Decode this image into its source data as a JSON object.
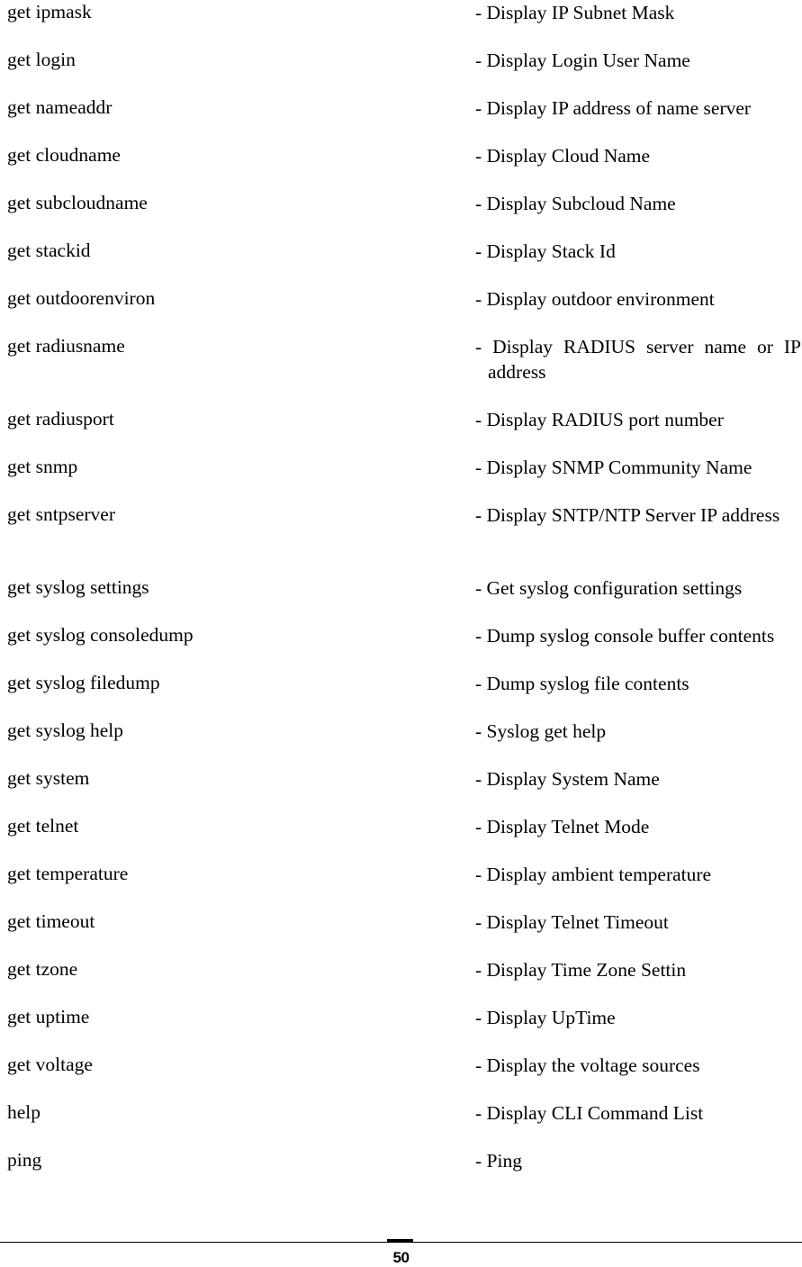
{
  "document": {
    "page_number": "50"
  },
  "command_list": {
    "rows": [
      {
        "command": "get ipmask",
        "description": "- Display IP Subnet Mask",
        "wrapped": false,
        "justified": false
      },
      {
        "command": "get login",
        "description": "- Display Login User Name",
        "wrapped": false,
        "justified": false
      },
      {
        "command": "get nameaddr",
        "description": "- Display IP address of name server",
        "wrapped": false,
        "justified": false
      },
      {
        "command": "get cloudname",
        "description": "- Display Cloud Name",
        "wrapped": false,
        "justified": false
      },
      {
        "command": "get subcloudname",
        "description": "- Display Subcloud Name",
        "wrapped": false,
        "justified": false
      },
      {
        "command": "get stackid",
        "description": "- Display Stack Id",
        "wrapped": false,
        "justified": false
      },
      {
        "command": "get outdoorenviron",
        "description": "- Display outdoor environment",
        "wrapped": false,
        "justified": false
      },
      {
        "command": "get radiusname",
        "description": "- Display RADIUS server name or IP address",
        "wrapped": true,
        "justified": true
      },
      {
        "command": "get radiusport",
        "description": "- Display RADIUS port number",
        "wrapped": false,
        "justified": false
      },
      {
        "command": "get snmp",
        "description": "- Display SNMP Community Name",
        "wrapped": false,
        "justified": false
      },
      {
        "command": "get sntpserver",
        "description": "- Display SNTP/NTP Server IP address",
        "wrapped": true,
        "justified": false
      },
      {
        "command": "get syslog settings",
        "description": "- Get syslog configuration settings",
        "wrapped": false,
        "justified": false
      },
      {
        "command": "get syslog consoledump",
        "description": "- Dump syslog console buffer contents",
        "wrapped": false,
        "justified": false
      },
      {
        "command": "get syslog filedump",
        "description": "- Dump syslog file contents",
        "wrapped": false,
        "justified": false
      },
      {
        "command": "get syslog help",
        "description": "- Syslog get help",
        "wrapped": false,
        "justified": false
      },
      {
        "command": "get system",
        "description": "- Display System Name",
        "wrapped": false,
        "justified": false
      },
      {
        "command": "get telnet",
        "description": "- Display Telnet Mode",
        "wrapped": false,
        "justified": false
      },
      {
        "command": "get temperature",
        "description": "- Display ambient temperature",
        "wrapped": false,
        "justified": false
      },
      {
        "command": "get timeout",
        "description": "- Display Telnet Timeout",
        "wrapped": false,
        "justified": false
      },
      {
        "command": "get tzone",
        "description": "- Display Time Zone Settin",
        "wrapped": false,
        "justified": false
      },
      {
        "command": "get uptime",
        "description": "- Display UpTime",
        "wrapped": false,
        "justified": false
      },
      {
        "command": "get voltage",
        "description": "- Display the voltage sources",
        "wrapped": false,
        "justified": false
      },
      {
        "command": "help",
        "description": "- Display CLI Command List",
        "wrapped": false,
        "justified": false
      },
      {
        "command": "ping",
        "description": "- Ping",
        "wrapped": false,
        "justified": false
      }
    ]
  }
}
